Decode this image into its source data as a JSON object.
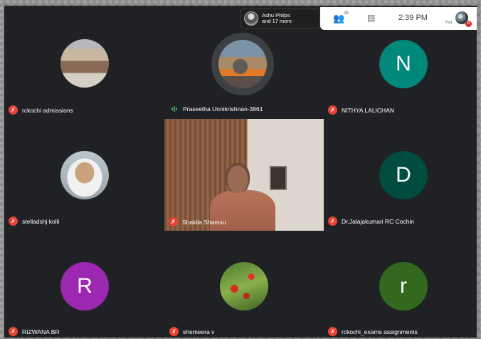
{
  "topbar": {
    "participants_chip": {
      "name": "Ashu Philps",
      "more": "and 17 more"
    },
    "participant_count": "28",
    "time": "2:39 PM",
    "you_label": "You",
    "notification_count": "5"
  },
  "participants": [
    {
      "name": "rckochi admissions",
      "muted": true,
      "avatar_type": "photo"
    },
    {
      "name": "Praseetha Unnikrishnan-3861",
      "muted": false,
      "speaking": true,
      "avatar_type": "photo"
    },
    {
      "name": "NITHYA LALICHAN",
      "muted": true,
      "initial": "N",
      "color": "#00897b"
    },
    {
      "name": "stelladshj kolli",
      "muted": true,
      "avatar_type": "photo"
    },
    {
      "name": "Shakila Shamsu",
      "muted": true,
      "avatar_type": "video"
    },
    {
      "name": "Dr.Jalajakumari RC Cochin",
      "muted": true,
      "initial": "D",
      "color": "#004d40"
    },
    {
      "name": "RIZWANA BR",
      "muted": true,
      "initial": "R",
      "color": "#9c27b0"
    },
    {
      "name": "shemeera v",
      "muted": true,
      "avatar_type": "photo"
    },
    {
      "name": "rckochi_exams assignments",
      "muted": true,
      "initial": "r",
      "color": "#33691e"
    }
  ]
}
